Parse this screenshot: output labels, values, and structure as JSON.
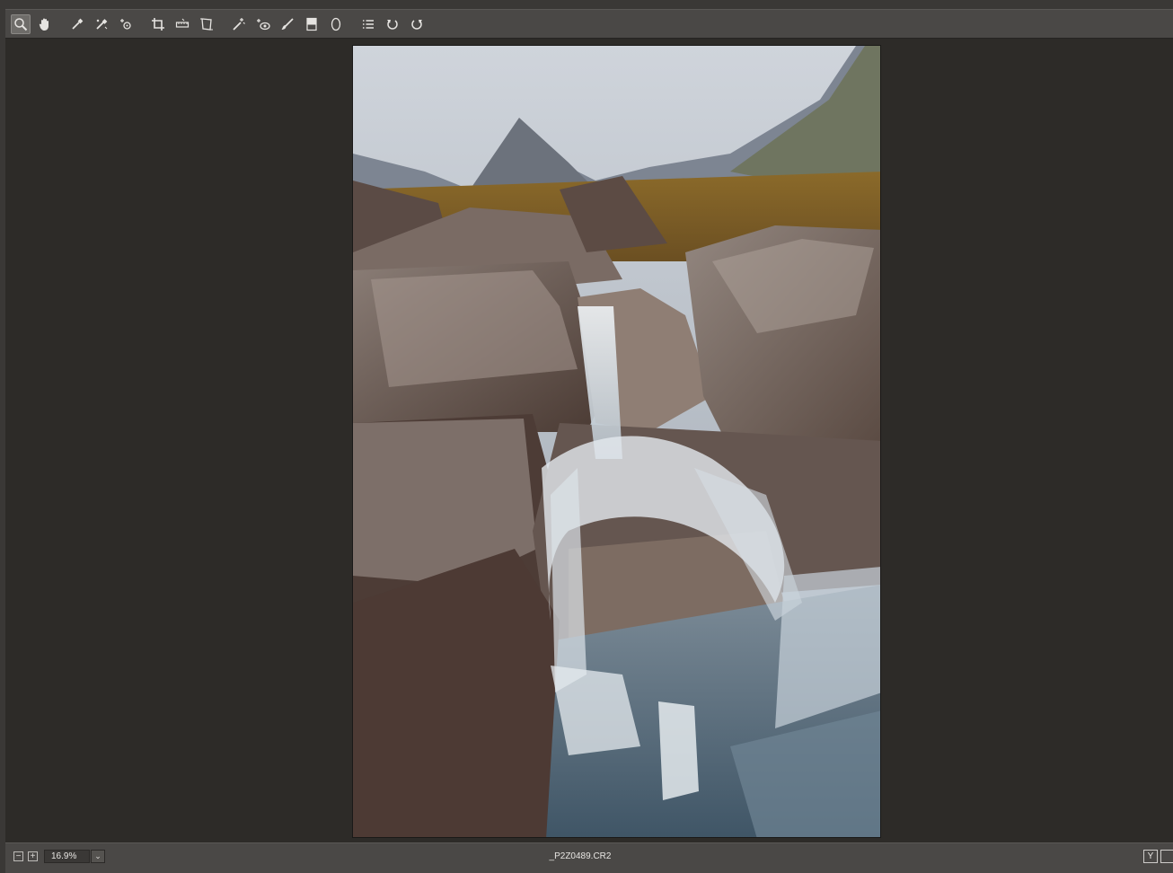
{
  "toolbar": {
    "tools": [
      {
        "icon": "zoom-icon",
        "active": true
      },
      {
        "icon": "hand-icon"
      },
      {
        "icon": "white-balance-icon"
      },
      {
        "icon": "color-sampler-icon"
      },
      {
        "icon": "targeted-adjustment-icon"
      },
      {
        "icon": "crop-icon"
      },
      {
        "icon": "straighten-icon"
      },
      {
        "icon": "transform-icon"
      },
      {
        "icon": "spot-removal-icon"
      },
      {
        "icon": "red-eye-icon"
      },
      {
        "icon": "adjustment-brush-icon"
      },
      {
        "icon": "graduated-filter-icon"
      },
      {
        "icon": "radial-filter-icon"
      },
      {
        "icon": "preferences-icon"
      },
      {
        "icon": "rotate-left-icon"
      },
      {
        "icon": "rotate-right-icon"
      }
    ]
  },
  "status": {
    "zoom_value": "16.9%",
    "filename": "_P2Z0489.CR2",
    "zoom_out_label": "−",
    "zoom_in_label": "+",
    "dropdown_label": "⌄",
    "view_toggle_label": "Y"
  },
  "colors": {
    "toolbar_bg": "#4a4846",
    "canvas_bg": "#2d2b28",
    "icon_color": "#e6e4e1"
  }
}
